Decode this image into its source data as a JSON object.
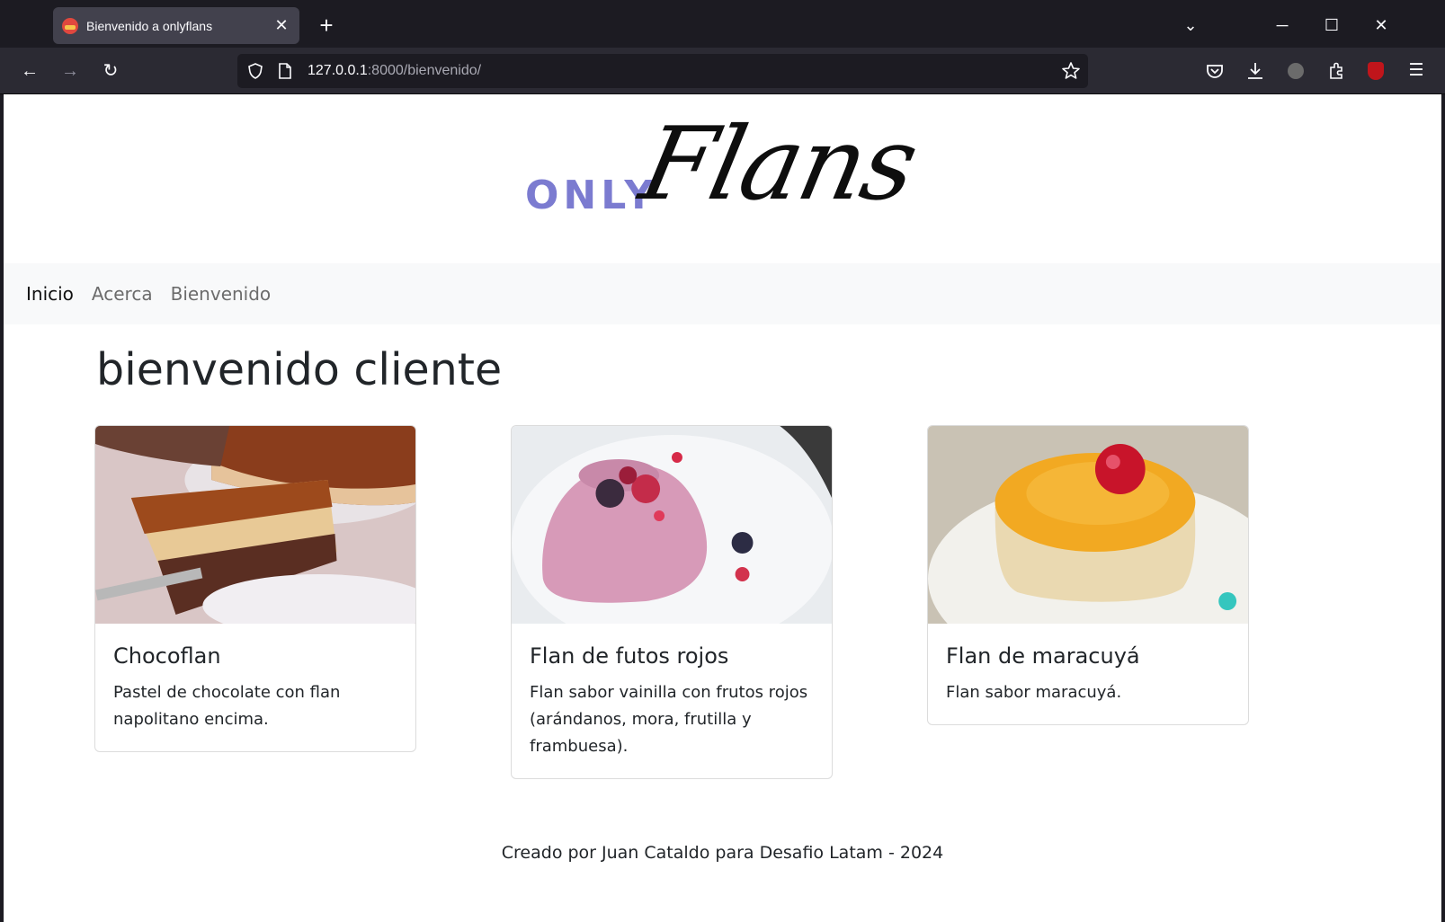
{
  "browser": {
    "tab_title": "Bienvenido a onlyflans",
    "url_host": "127.0.0.1",
    "url_rest": ":8000/bienvenido/"
  },
  "site": {
    "logo_only": "ONLY",
    "logo_flans": "Flans",
    "nav": [
      {
        "label": "Inicio"
      },
      {
        "label": "Acerca"
      },
      {
        "label": "Bienvenido"
      }
    ],
    "heading": "bienvenido cliente",
    "cards": [
      {
        "title": "Chocoflan",
        "text": "Pastel de chocolate con flan napolitano encima."
      },
      {
        "title": "Flan de futos rojos",
        "text": "Flan sabor vainilla con frutos rojos (arándanos, mora, frutilla y frambuesa)."
      },
      {
        "title": "Flan de maracuyá",
        "text": "Flan sabor maracuyá."
      }
    ],
    "footer": "Creado por Juan Cataldo para Desafio Latam - 2024"
  },
  "colors": {
    "logo_accent": "#7b7bd0",
    "browser_chrome": "#1c1b22",
    "toolbar": "#2b2a33"
  }
}
